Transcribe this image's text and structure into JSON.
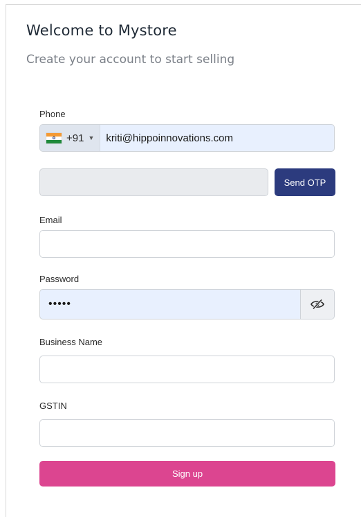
{
  "header": {
    "title": "Welcome to Mystore",
    "subtitle": "Create your account to start selling"
  },
  "phone": {
    "label": "Phone",
    "country_flag": "india-flag-icon",
    "dial_code": "+91",
    "value": "kriti@hippoinnovations.com"
  },
  "otp": {
    "value": "",
    "button_label": "Send OTP"
  },
  "email": {
    "label": "Email",
    "value": ""
  },
  "password": {
    "label": "Password",
    "value": "•••••",
    "toggle_icon": "eye-slash-icon"
  },
  "business_name": {
    "label": "Business Name",
    "value": ""
  },
  "gstin": {
    "label": "GSTIN",
    "value": ""
  },
  "signup": {
    "label": "Sign up"
  },
  "colors": {
    "primary": "#2c3b7e",
    "accent": "#dc4590",
    "autofill_bg": "#e8f0fe"
  }
}
